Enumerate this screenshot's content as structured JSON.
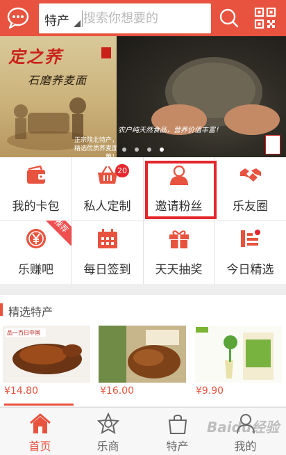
{
  "header": {
    "search_category": "特产",
    "search_placeholder": "搜索你想要的"
  },
  "banner": {
    "brand": "定之荞",
    "subtitle": "石磨荞麦面",
    "caption_line1": "正宗陕北特产，",
    "caption_line2": "精选优质荞麦面粮！",
    "slogan": "农户纯天然食品，营养价值丰富！",
    "slides": 4,
    "active_slide": 4
  },
  "grid": {
    "items": [
      {
        "label": "我的卡包",
        "icon": "wallet-icon"
      },
      {
        "label": "私人定制",
        "icon": "basket-icon",
        "badge": "20"
      },
      {
        "label": "邀请粉丝",
        "icon": "person-icon"
      },
      {
        "label": "乐友圈",
        "icon": "handshake-icon"
      },
      {
        "label": "乐赚吧",
        "icon": "yen-coin-icon",
        "ribbon": "推荐"
      },
      {
        "label": "每日签到",
        "icon": "calendar-icon"
      },
      {
        "label": "天天抽奖",
        "icon": "gift-icon"
      },
      {
        "label": "今日精选",
        "icon": "list-icon"
      }
    ]
  },
  "featured": {
    "title": "精选特产",
    "products": [
      {
        "price": "¥14.80",
        "image": "roast-duck-image",
        "label_text": "品一百日中国"
      },
      {
        "price": "¥16.00",
        "image": "braised-meat-image"
      },
      {
        "price": "¥9.90",
        "image": "herbal-tea-image"
      }
    ]
  },
  "tabbar": {
    "tabs": [
      {
        "label": "首页",
        "icon": "home-icon",
        "active": true
      },
      {
        "label": "乐商",
        "icon": "star-badge-icon",
        "active": false
      },
      {
        "label": "特产",
        "icon": "shopping-bag-icon",
        "active": false
      },
      {
        "label": "我的",
        "icon": "user-icon",
        "active": false
      }
    ]
  },
  "colors": {
    "brand": "#e8533f",
    "highlight": "#e4262c"
  },
  "watermark": "Baidu经验"
}
